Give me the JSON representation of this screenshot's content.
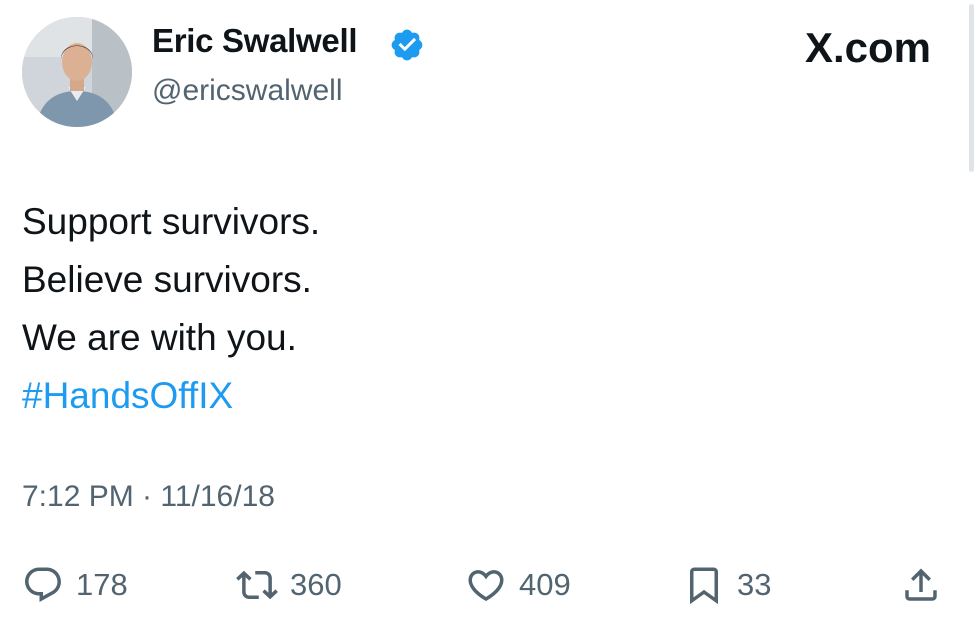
{
  "brand": {
    "label": "X.com"
  },
  "author": {
    "display_name": "Eric Swalwell",
    "handle": "@ericswalwell",
    "verified": true,
    "verified_color": "#1d9bf0"
  },
  "post": {
    "lines": [
      "Support survivors.",
      "Believe survivors.",
      "We are with you."
    ],
    "hashtag": "#HandsOffIX",
    "timestamp": "7:12 PM · 11/16/18"
  },
  "metrics": {
    "replies": "178",
    "reposts": "360",
    "likes": "409",
    "bookmarks": "33"
  },
  "icons": {
    "reply": "speech-bubble-icon",
    "repost": "repost-arrows-icon",
    "like": "heart-icon",
    "bookmark": "bookmark-icon",
    "share": "share-upload-icon"
  },
  "colors": {
    "text": "#0f1419",
    "secondary": "#536471",
    "link": "#1d9bf0"
  }
}
